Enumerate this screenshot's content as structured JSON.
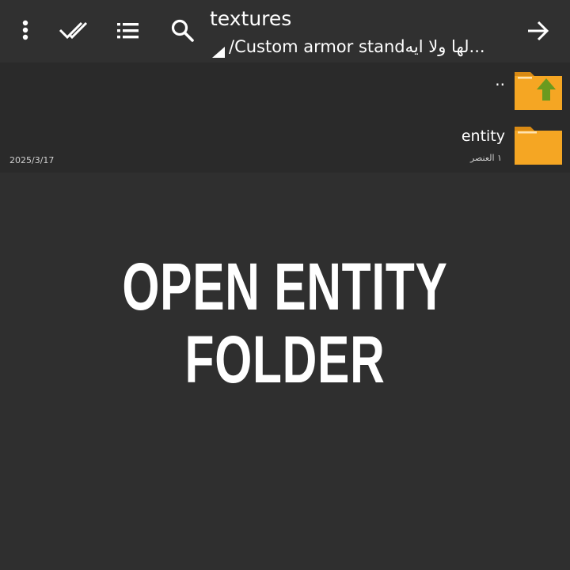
{
  "toolbar": {
    "title": "textures",
    "path": "/Custom armor stand‫لها ولا ايه‬...",
    "icons": [
      "more-vert-icon",
      "double-check-icon",
      "list-view-icon",
      "search-icon",
      "arrow-forward-icon"
    ]
  },
  "file_list": {
    "items": [
      {
        "name": "..",
        "icon": "folder-up-icon"
      },
      {
        "name": "entity",
        "count": "١ العنصر",
        "date": "2025/3/17",
        "icon": "folder-icon"
      }
    ]
  },
  "caption": "OPEN ENTITY FOLDER",
  "colors": {
    "background": "#2f2f2f",
    "list_background": "#2a2a2a",
    "folder": "#f5a623",
    "folder_dark": "#d98a14",
    "up_arrow": "#6a9a1f"
  }
}
